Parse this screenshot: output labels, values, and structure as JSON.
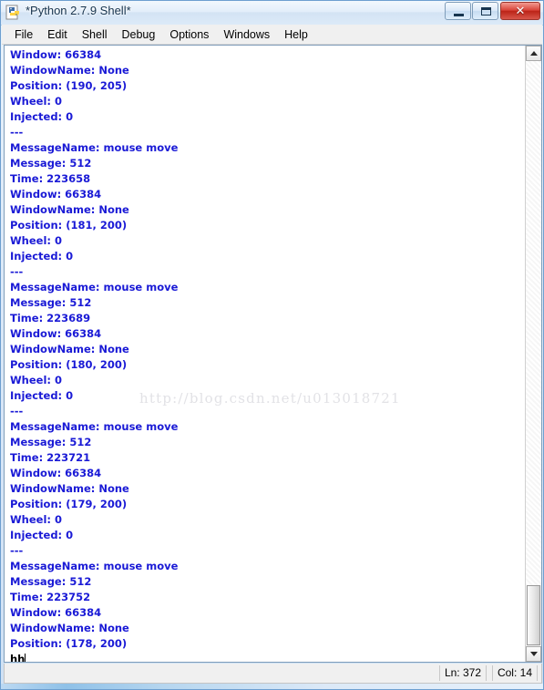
{
  "window": {
    "title": "*Python 2.7.9 Shell*",
    "icon": "python-logo-icon",
    "controls": {
      "minimize_label": "Minimize",
      "maximize_label": "Maximize",
      "close_label": "✕"
    }
  },
  "menubar": {
    "items": [
      {
        "label": "File"
      },
      {
        "label": "Edit"
      },
      {
        "label": "Shell"
      },
      {
        "label": "Debug"
      },
      {
        "label": "Options"
      },
      {
        "label": "Windows"
      },
      {
        "label": "Help"
      }
    ]
  },
  "shell": {
    "text_color": "#1a1ad6",
    "input_color": "#000000",
    "lines": [
      {
        "text": "Window: 66384",
        "kind": "output"
      },
      {
        "text": "WindowName: None",
        "kind": "output"
      },
      {
        "text": "Position: (190, 205)",
        "kind": "output"
      },
      {
        "text": "Wheel: 0",
        "kind": "output"
      },
      {
        "text": "Injected: 0",
        "kind": "output"
      },
      {
        "text": "---",
        "kind": "separator"
      },
      {
        "text": "MessageName: mouse move",
        "kind": "output"
      },
      {
        "text": "Message: 512",
        "kind": "output"
      },
      {
        "text": "Time: 223658",
        "kind": "output"
      },
      {
        "text": "Window: 66384",
        "kind": "output"
      },
      {
        "text": "WindowName: None",
        "kind": "output"
      },
      {
        "text": "Position: (181, 200)",
        "kind": "output"
      },
      {
        "text": "Wheel: 0",
        "kind": "output"
      },
      {
        "text": "Injected: 0",
        "kind": "output"
      },
      {
        "text": "---",
        "kind": "separator"
      },
      {
        "text": "MessageName: mouse move",
        "kind": "output"
      },
      {
        "text": "Message: 512",
        "kind": "output"
      },
      {
        "text": "Time: 223689",
        "kind": "output"
      },
      {
        "text": "Window: 66384",
        "kind": "output"
      },
      {
        "text": "WindowName: None",
        "kind": "output"
      },
      {
        "text": "Position: (180, 200)",
        "kind": "output"
      },
      {
        "text": "Wheel: 0",
        "kind": "output"
      },
      {
        "text": "Injected: 0",
        "kind": "output"
      },
      {
        "text": "---",
        "kind": "separator"
      },
      {
        "text": "MessageName: mouse move",
        "kind": "output"
      },
      {
        "text": "Message: 512",
        "kind": "output"
      },
      {
        "text": "Time: 223721",
        "kind": "output"
      },
      {
        "text": "Window: 66384",
        "kind": "output"
      },
      {
        "text": "WindowName: None",
        "kind": "output"
      },
      {
        "text": "Position: (179, 200)",
        "kind": "output"
      },
      {
        "text": "Wheel: 0",
        "kind": "output"
      },
      {
        "text": "Injected: 0",
        "kind": "output"
      },
      {
        "text": "---",
        "kind": "separator"
      },
      {
        "text": "MessageName: mouse move",
        "kind": "output"
      },
      {
        "text": "Message: 512",
        "kind": "output"
      },
      {
        "text": "Time: 223752",
        "kind": "output"
      },
      {
        "text": "Window: 66384",
        "kind": "output"
      },
      {
        "text": "WindowName: None",
        "kind": "output"
      },
      {
        "text": "Position: (178, 200)",
        "kind": "output"
      },
      {
        "text": "hh",
        "kind": "input"
      }
    ]
  },
  "watermark": {
    "text": "http://blog.csdn.net/u013018721"
  },
  "scrollbar": {
    "up_arrow": "scroll-up-arrow",
    "down_arrow": "scroll-down-arrow"
  },
  "statusbar": {
    "line": "Ln: 372",
    "column": "Col: 14"
  }
}
